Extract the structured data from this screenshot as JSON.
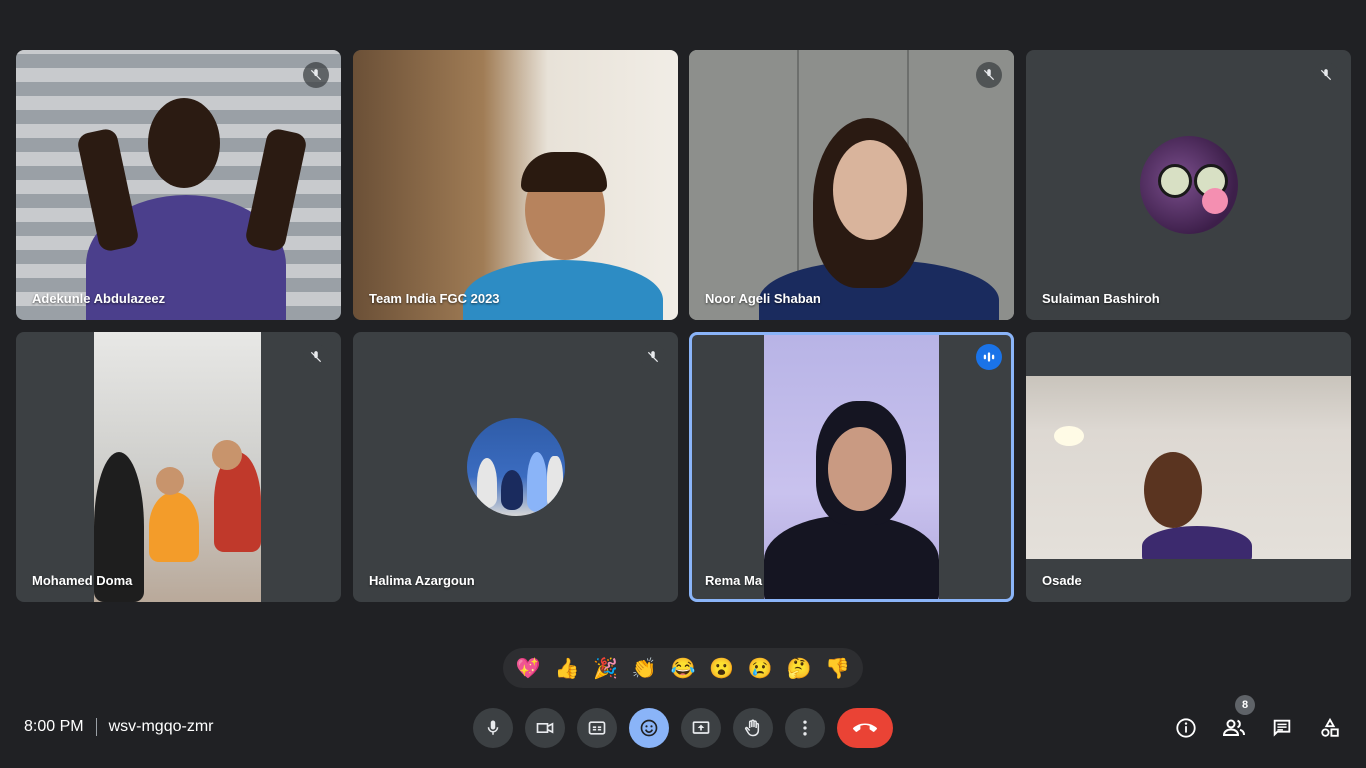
{
  "participants": [
    {
      "name": "Adekunle Abdulazeez",
      "muted": true
    },
    {
      "name": "Team India FGC 2023",
      "muted": false
    },
    {
      "name": "Noor Ageli Shaban",
      "muted": true
    },
    {
      "name": "Sulaiman Bashiroh",
      "muted": true
    },
    {
      "name": "Mohamed Doma",
      "muted": true
    },
    {
      "name": "Halima Azargoun",
      "muted": true
    },
    {
      "name": "Rema Ma",
      "muted": false,
      "speaking": true
    },
    {
      "name": "Osade",
      "muted": false
    }
  ],
  "reactions": [
    "💖",
    "👍",
    "🎉",
    "👏",
    "😂",
    "😮",
    "😢",
    "🤔",
    "👎"
  ],
  "meeting": {
    "time": "8:00 PM",
    "code": "wsv-mgqo-zmr"
  },
  "people_count": "8",
  "icons": {
    "mic": "mic-icon",
    "camera": "camera-icon",
    "captions": "captions-icon",
    "emoji": "emoji-icon",
    "present": "present-icon",
    "hand": "raise-hand-icon",
    "more": "more-options-icon",
    "end": "end-call-icon",
    "info": "info-icon",
    "people": "people-icon",
    "chat": "chat-icon",
    "activities": "activities-icon"
  },
  "colors": {
    "background": "#202124",
    "tile": "#3c4043",
    "active_outline": "#8ab4f8",
    "end_call": "#ea4335",
    "emoji_active": "#8ab4f8"
  }
}
